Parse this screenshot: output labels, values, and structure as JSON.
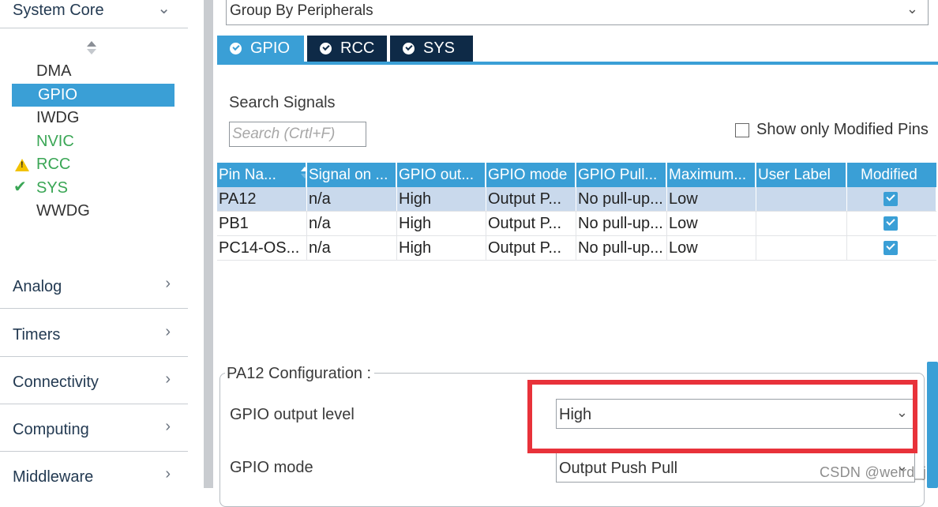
{
  "sidebar": {
    "system_core": "System Core",
    "peripherals": [
      {
        "label": "DMA",
        "status": "none"
      },
      {
        "label": "GPIO",
        "status": "selected"
      },
      {
        "label": "IWDG",
        "status": "none"
      },
      {
        "label": "NVIC",
        "status": "green"
      },
      {
        "label": "RCC",
        "status": "warning"
      },
      {
        "label": "SYS",
        "status": "ok"
      },
      {
        "label": "WWDG",
        "status": "none"
      }
    ],
    "categories": [
      "Analog",
      "Timers",
      "Connectivity",
      "Computing",
      "Middleware"
    ]
  },
  "main": {
    "group_by": "Group By Peripherals",
    "tabs": [
      {
        "label": "GPIO",
        "active": true
      },
      {
        "label": "RCC",
        "active": false
      },
      {
        "label": "SYS",
        "active": false
      }
    ],
    "search_title": "Search Signals",
    "search_placeholder": "Search (Crtl+F)",
    "show_modified_label": "Show only Modified Pins",
    "table": {
      "headers": [
        "Pin Na...",
        "Signal on ...",
        "GPIO out...",
        "GPIO mode",
        "GPIO Pull...",
        "Maximum...",
        "User Label",
        "Modified"
      ],
      "rows": [
        {
          "pin": "PA12",
          "signal": "n/a",
          "output": "High",
          "mode": "Output P...",
          "pull": "No pull-up...",
          "max": "Low",
          "label": "",
          "modified": true
        },
        {
          "pin": "PB1",
          "signal": "n/a",
          "output": "High",
          "mode": "Output P...",
          "pull": "No pull-up...",
          "max": "Low",
          "label": "",
          "modified": true
        },
        {
          "pin": "PC14-OS...",
          "signal": "n/a",
          "output": "High",
          "mode": "Output P...",
          "pull": "No pull-up...",
          "max": "Low",
          "label": "",
          "modified": true
        }
      ]
    },
    "config": {
      "title": "PA12 Configuration :",
      "output_level_label": "GPIO output level",
      "output_level_value": "High",
      "mode_label": "GPIO mode",
      "mode_value": "Output Push Pull"
    }
  },
  "watermark": "CSDN @weird_j",
  "colors": {
    "accent": "#3a9fd6",
    "tab_dark": "#0e2a47",
    "highlight": "#e8323a",
    "ok_green": "#3aa655",
    "warn_yellow": "#f2c200"
  },
  "icons": {
    "collapse": "chevron-up-icon",
    "expand": "chevron-right-icon",
    "dropdown": "chevron-down-icon",
    "warning": "warning-icon",
    "ok": "check-icon"
  }
}
